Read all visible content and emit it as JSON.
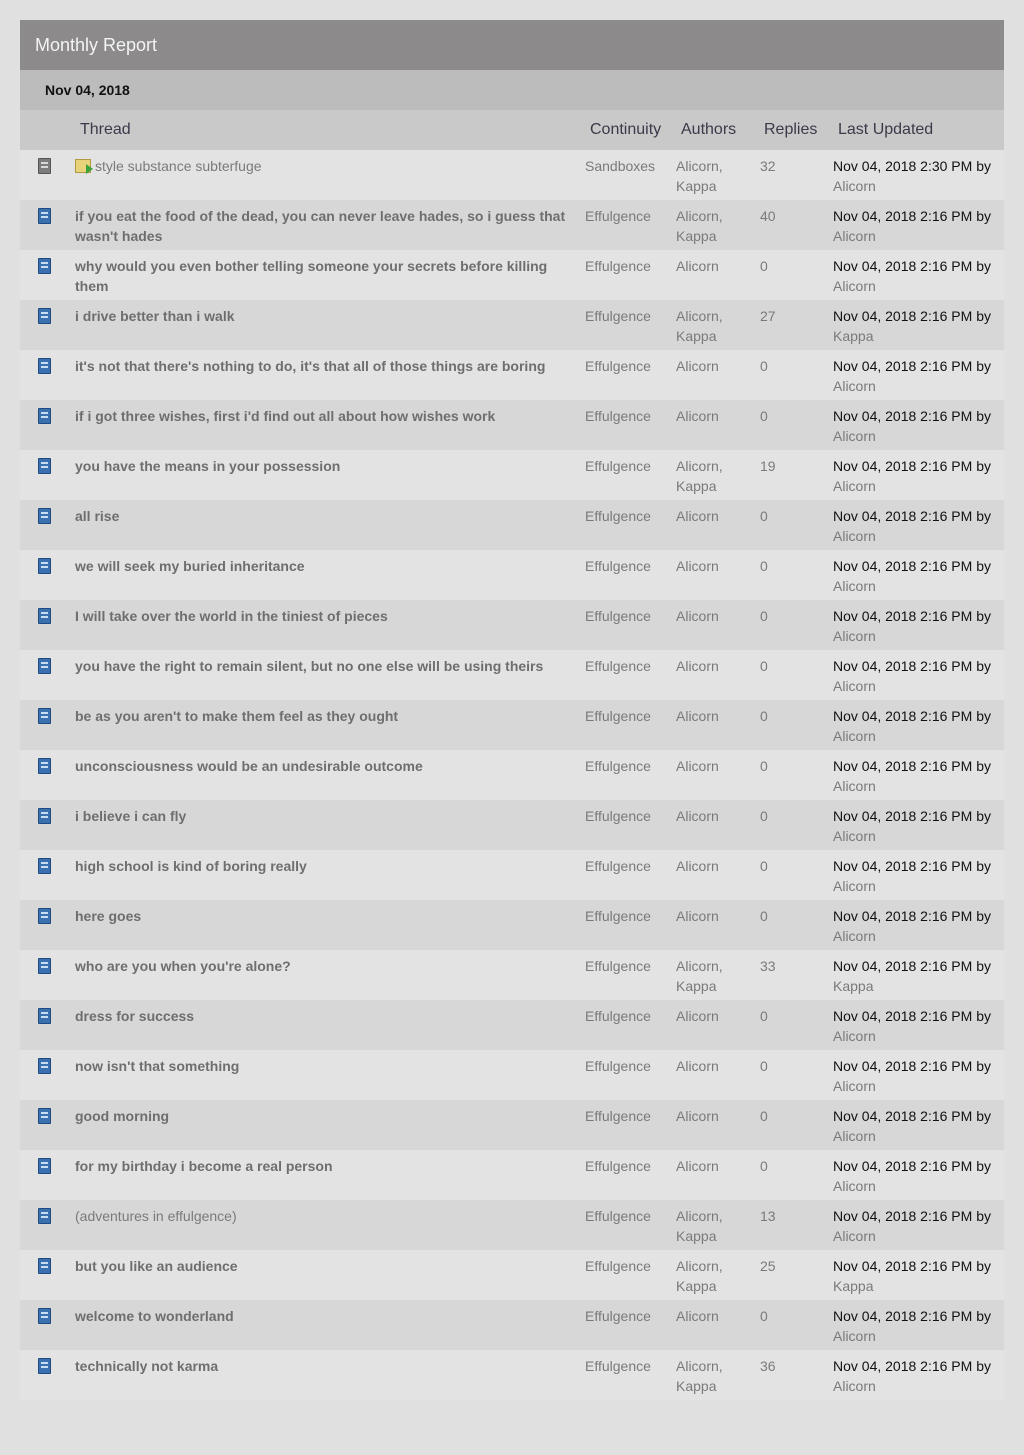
{
  "header": {
    "title": "Monthly Report"
  },
  "date_heading": "Nov 04, 2018",
  "columns": {
    "thread": "Thread",
    "continuity": "Continuity",
    "authors": "Authors",
    "replies": "Replies",
    "last_updated": "Last Updated"
  },
  "by_word": "by",
  "rows": [
    {
      "title": "style substance subterfuge",
      "continuity": "Sandboxes",
      "authors": [
        "Alicorn,",
        "Kappa"
      ],
      "replies": "32",
      "updated": "Nov 04, 2018 2:30 PM",
      "by": "Alicorn",
      "icon": "grey-book-icon"
    },
    {
      "title": "if you eat the food of the dead, you can never leave hades, so i guess that wasn't hades",
      "continuity": "Effulgence",
      "authors": [
        "Alicorn,",
        "Kappa"
      ],
      "replies": "40",
      "updated": "Nov 04, 2018 2:16 PM",
      "by": "Alicorn"
    },
    {
      "title": "why would you even bother telling someone your secrets before killing them",
      "continuity": "Effulgence",
      "authors": [
        "Alicorn"
      ],
      "replies": "0",
      "updated": "Nov 04, 2018 2:16 PM",
      "by": "Alicorn"
    },
    {
      "title": "i drive better than i walk",
      "continuity": "Effulgence",
      "authors": [
        "Alicorn,",
        "Kappa"
      ],
      "replies": "27",
      "updated": "Nov 04, 2018 2:16 PM",
      "by": "Kappa"
    },
    {
      "title": "it's not that there's nothing to do, it's that all of those things are boring",
      "continuity": "Effulgence",
      "authors": [
        "Alicorn"
      ],
      "replies": "0",
      "updated": "Nov 04, 2018 2:16 PM",
      "by": "Alicorn"
    },
    {
      "title": "if i got three wishes, first i'd find out all about how wishes work",
      "continuity": "Effulgence",
      "authors": [
        "Alicorn"
      ],
      "replies": "0",
      "updated": "Nov 04, 2018 2:16 PM",
      "by": "Alicorn"
    },
    {
      "title": "you have the means in your possession",
      "continuity": "Effulgence",
      "authors": [
        "Alicorn,",
        "Kappa"
      ],
      "replies": "19",
      "updated": "Nov 04, 2018 2:16 PM",
      "by": "Alicorn"
    },
    {
      "title": "all rise",
      "continuity": "Effulgence",
      "authors": [
        "Alicorn"
      ],
      "replies": "0",
      "updated": "Nov 04, 2018 2:16 PM",
      "by": "Alicorn"
    },
    {
      "title": "we will seek my buried inheritance",
      "continuity": "Effulgence",
      "authors": [
        "Alicorn"
      ],
      "replies": "0",
      "updated": "Nov 04, 2018 2:16 PM",
      "by": "Alicorn"
    },
    {
      "title": "I will take over the world in the tiniest of pieces",
      "continuity": "Effulgence",
      "authors": [
        "Alicorn"
      ],
      "replies": "0",
      "updated": "Nov 04, 2018 2:16 PM",
      "by": "Alicorn"
    },
    {
      "title": "you have the right to remain silent, but no one else will be using theirs",
      "continuity": "Effulgence",
      "authors": [
        "Alicorn"
      ],
      "replies": "0",
      "updated": "Nov 04, 2018 2:16 PM",
      "by": "Alicorn"
    },
    {
      "title": "be as you aren't to make them feel as they ought",
      "continuity": "Effulgence",
      "authors": [
        "Alicorn"
      ],
      "replies": "0",
      "updated": "Nov 04, 2018 2:16 PM",
      "by": "Alicorn"
    },
    {
      "title": "unconsciousness would be an undesirable outcome",
      "continuity": "Effulgence",
      "authors": [
        "Alicorn"
      ],
      "replies": "0",
      "updated": "Nov 04, 2018 2:16 PM",
      "by": "Alicorn"
    },
    {
      "title": "i believe i can fly",
      "continuity": "Effulgence",
      "authors": [
        "Alicorn"
      ],
      "replies": "0",
      "updated": "Nov 04, 2018 2:16 PM",
      "by": "Alicorn"
    },
    {
      "title": "high school is kind of boring really",
      "continuity": "Effulgence",
      "authors": [
        "Alicorn"
      ],
      "replies": "0",
      "updated": "Nov 04, 2018 2:16 PM",
      "by": "Alicorn"
    },
    {
      "title": "here goes",
      "continuity": "Effulgence",
      "authors": [
        "Alicorn"
      ],
      "replies": "0",
      "updated": "Nov 04, 2018 2:16 PM",
      "by": "Alicorn"
    },
    {
      "title": "who are you when you're alone?",
      "continuity": "Effulgence",
      "authors": [
        "Alicorn,",
        "Kappa"
      ],
      "replies": "33",
      "updated": "Nov 04, 2018 2:16 PM",
      "by": "Kappa"
    },
    {
      "title": "dress for success",
      "continuity": "Effulgence",
      "authors": [
        "Alicorn"
      ],
      "replies": "0",
      "updated": "Nov 04, 2018 2:16 PM",
      "by": "Alicorn"
    },
    {
      "title": "now isn't that something",
      "continuity": "Effulgence",
      "authors": [
        "Alicorn"
      ],
      "replies": "0",
      "updated": "Nov 04, 2018 2:16 PM",
      "by": "Alicorn"
    },
    {
      "title": "good morning",
      "continuity": "Effulgence",
      "authors": [
        "Alicorn"
      ],
      "replies": "0",
      "updated": "Nov 04, 2018 2:16 PM",
      "by": "Alicorn"
    },
    {
      "title": "for my birthday i become a real person",
      "continuity": "Effulgence",
      "authors": [
        "Alicorn"
      ],
      "replies": "0",
      "updated": "Nov 04, 2018 2:16 PM",
      "by": "Alicorn"
    },
    {
      "title": "(adventures in effulgence)",
      "continuity": "Effulgence",
      "authors": [
        "Alicorn,",
        "Kappa"
      ],
      "replies": "13",
      "updated": "Nov 04, 2018 2:16 PM",
      "by": "Alicorn",
      "plain": true
    },
    {
      "title": "but you like an audience",
      "continuity": "Effulgence",
      "authors": [
        "Alicorn,",
        "Kappa"
      ],
      "replies": "25",
      "updated": "Nov 04, 2018 2:16 PM",
      "by": "Kappa"
    },
    {
      "title": "welcome to wonderland",
      "continuity": "Effulgence",
      "authors": [
        "Alicorn"
      ],
      "replies": "0",
      "updated": "Nov 04, 2018 2:16 PM",
      "by": "Alicorn"
    },
    {
      "title": "technically not karma",
      "continuity": "Effulgence",
      "authors": [
        "Alicorn,",
        "Kappa"
      ],
      "replies": "36",
      "updated": "Nov 04, 2018 2:16 PM",
      "by": "Alicorn"
    }
  ]
}
